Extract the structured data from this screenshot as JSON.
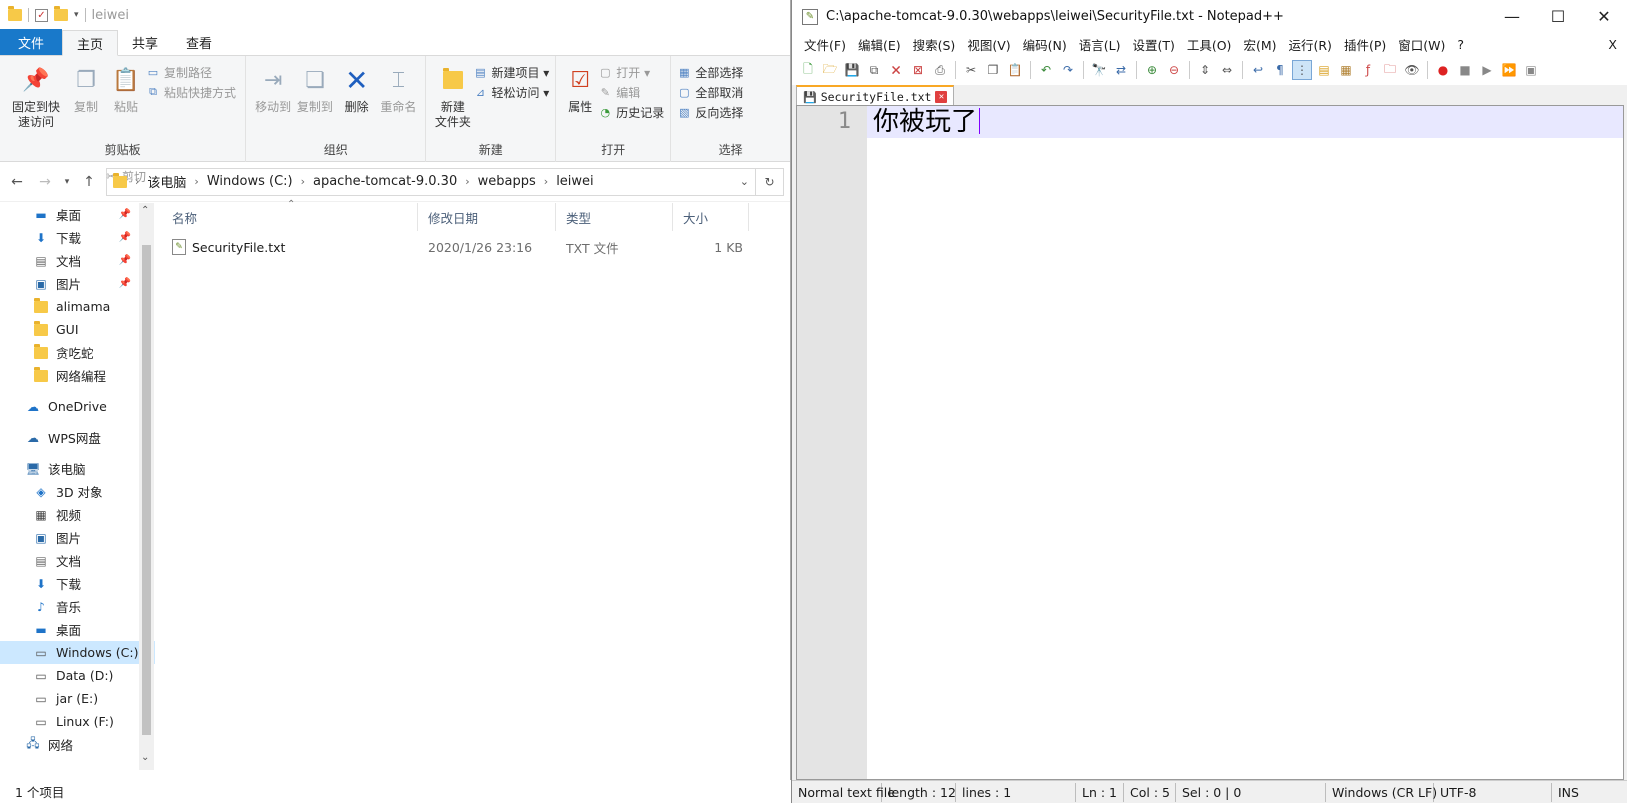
{
  "explorer": {
    "title": "leiwei",
    "tabs": [
      "文件",
      "主页",
      "共享",
      "查看"
    ],
    "ribbon": {
      "pin_label_1": "固定到快",
      "pin_label_2": "速访问",
      "copy": "复制",
      "paste": "粘贴",
      "copy_path": "复制路径",
      "paste_shortcut": "粘贴快捷方式",
      "cut": "剪切",
      "clipboard": "剪贴板",
      "move_to": "移动到",
      "copy_to": "复制到",
      "delete": "删除",
      "rename": "重命名",
      "organize": "组织",
      "new_folder_1": "新建",
      "new_folder_2": "文件夹",
      "new_item": "新建项目 ▾",
      "easy_access": "轻松访问 ▾",
      "new": "新建",
      "properties": "属性",
      "open": "打开 ▾",
      "edit": "编辑",
      "history": "历史记录",
      "open_group": "打开",
      "select_all": "全部选择",
      "select_none": "全部取消",
      "invert_selection": "反向选择",
      "select_group": "选择"
    },
    "breadcrumb": [
      "该电脑",
      "Windows (C:)",
      "apache-tomcat-9.0.30",
      "webapps",
      "leiwei"
    ],
    "nav": [
      {
        "label": "桌面",
        "pin": true
      },
      {
        "label": "下载",
        "pin": true
      },
      {
        "label": "文档",
        "pin": true
      },
      {
        "label": "图片",
        "pin": true
      },
      {
        "label": "alimama",
        "pin": false
      },
      {
        "label": "GUI",
        "pin": false
      },
      {
        "label": "贪吃蛇",
        "pin": false
      },
      {
        "label": "网络编程",
        "pin": false
      }
    ],
    "nav_roots": {
      "onedrive": "OneDrive",
      "wps": "WPS网盘",
      "pc": "该电脑"
    },
    "nav_pc": [
      "3D 对象",
      "视频",
      "图片",
      "文档",
      "下载",
      "音乐",
      "桌面",
      "Windows (C:)",
      "Data (D:)",
      "jar (E:)",
      "Linux (F:)"
    ],
    "nav_partial": "网络",
    "columns": {
      "name": "名称",
      "date": "修改日期",
      "type": "类型",
      "size": "大小"
    },
    "files": [
      {
        "name": "SecurityFile.txt",
        "date": "2020/1/26 23:16",
        "type": "TXT 文件",
        "size": "1 KB"
      }
    ],
    "status": "1 个项目"
  },
  "notepad": {
    "title": "C:\\apache-tomcat-9.0.30\\webapps\\leiwei\\SecurityFile.txt - Notepad++",
    "menu": [
      "文件(F)",
      "编辑(E)",
      "搜索(S)",
      "视图(V)",
      "编码(N)",
      "语言(L)",
      "设置(T)",
      "工具(O)",
      "宏(M)",
      "运行(R)",
      "插件(P)",
      "窗口(W)",
      "?"
    ],
    "menu_close": "X",
    "tab": "SecurityFile.txt",
    "line_number": "1",
    "content": "你被玩了",
    "status": {
      "type": "Normal text file",
      "length": "length : 12",
      "lines": "lines : 1",
      "ln": "Ln : 1",
      "col": "Col : 5",
      "sel": "Sel : 0 | 0",
      "eol": "Windows (CR LF)",
      "enc": "UTF-8",
      "mode": "INS"
    }
  }
}
